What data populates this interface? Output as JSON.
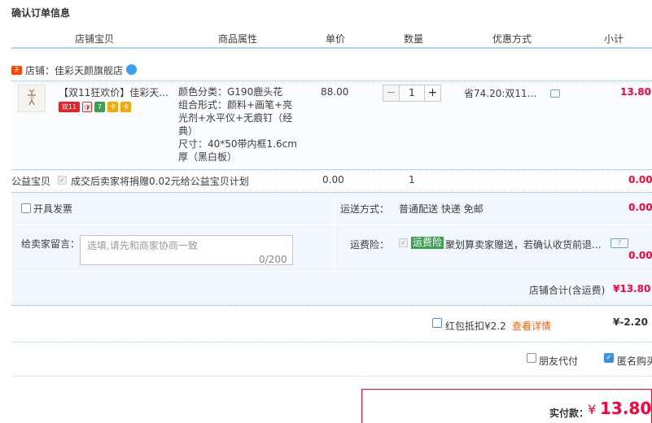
{
  "page": {
    "title": "确认订单信息"
  },
  "columns": [
    "店铺宝贝",
    "商品属性",
    "单价",
    "数量",
    "优惠方式",
    "小计"
  ],
  "shop": {
    "label": "店铺：佳彩天颜旗舰店",
    "badge": "天猫"
  },
  "item": {
    "title": "【双11狂欢价】佳彩天...",
    "tags": [
      "双11",
      "🛡",
      "7",
      "卡",
      "卡"
    ],
    "props": [
      "颜色分类：G190鹿头花",
      "组合形式：颜料+画笔+亮光剂+水平仪+无痕钉（经典）",
      "尺寸：40*50带内框1.6cm厚（黑白板）"
    ],
    "price": "88.00",
    "qty": "1",
    "discount": "省74.20:双11...",
    "subtotal": "13.80"
  },
  "charity": {
    "label": "公益宝贝",
    "text": "成交后卖家将捐赠0.02元给公益宝贝计划",
    "price": "0.00",
    "qty": "1",
    "total": "0.00"
  },
  "options": {
    "invoice_label": "开具发票",
    "shipping_label": "运送方式：",
    "shipping_value": "普通配送 快递 免邮",
    "shipping_total": "0.00",
    "note_label": "给卖家留言：",
    "note_placeholder": "选填,请先和商家协商一致",
    "note_count": "0/200",
    "insurance_label": "运费险：",
    "insurance_tag": "运费险",
    "insurance_text": "聚划算卖家赠送，若确认收货前退...",
    "insurance_total": "0.00",
    "shop_total_label": "店铺合计(含运费)",
    "shop_total_value": "¥13.80"
  },
  "redpack": {
    "label": "红包抵扣¥2.2",
    "link": "查看详情",
    "value": "¥-2.20"
  },
  "extra": {
    "friend_pay": "朋友代付",
    "anonymous": "匿名购买"
  },
  "payment": {
    "label": "实付款：",
    "currency": "¥",
    "amount": "13.80"
  }
}
